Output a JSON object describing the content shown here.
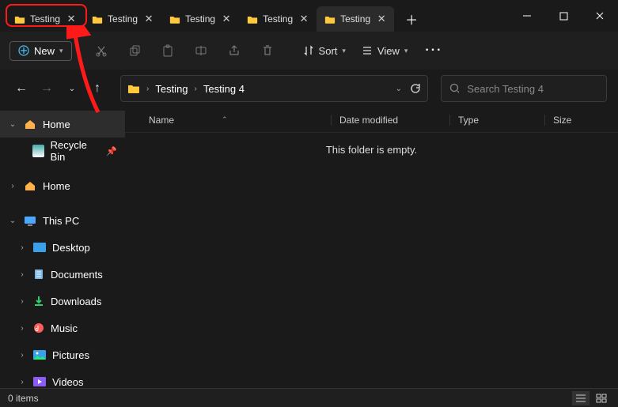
{
  "tabs": [
    {
      "label": "Testing"
    },
    {
      "label": "Testing"
    },
    {
      "label": "Testing"
    },
    {
      "label": "Testing"
    },
    {
      "label": "Testing"
    }
  ],
  "toolbar": {
    "new_label": "New",
    "sort_label": "Sort",
    "view_label": "View"
  },
  "breadcrumb": {
    "seg1": "Testing",
    "seg2": "Testing 4"
  },
  "search": {
    "placeholder": "Search Testing 4"
  },
  "sidebar": {
    "home": "Home",
    "recycle": "Recycle Bin",
    "home2": "Home",
    "thispc": "This PC",
    "desktop": "Desktop",
    "documents": "Documents",
    "downloads": "Downloads",
    "music": "Music",
    "pictures": "Pictures",
    "videos": "Videos"
  },
  "columns": {
    "name": "Name",
    "date": "Date modified",
    "type": "Type",
    "size": "Size"
  },
  "empty_text": "This folder is empty.",
  "status": {
    "items": "0 items"
  }
}
